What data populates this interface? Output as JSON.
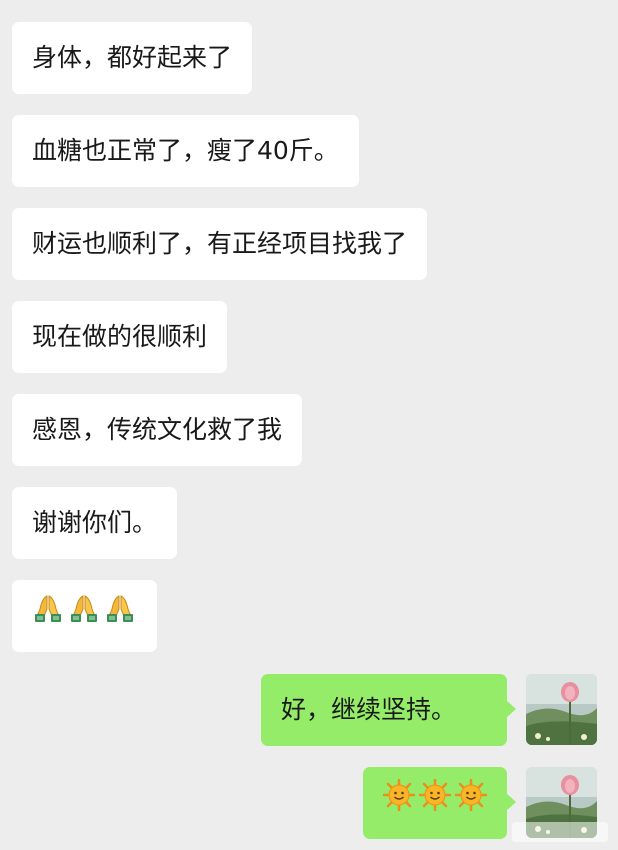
{
  "messages": [
    {
      "side": "in",
      "text": "身体，都好起来了"
    },
    {
      "side": "in",
      "text": "血糖也正常了，瘦了40斤。"
    },
    {
      "side": "in",
      "text": "财运也顺利了，有正经项目找我了"
    },
    {
      "side": "in",
      "text": "现在做的很顺利"
    },
    {
      "side": "in",
      "text": "感恩，传统文化救了我"
    },
    {
      "side": "in",
      "text": "谢谢你们。"
    },
    {
      "side": "in",
      "icons": [
        "pray-icon",
        "pray-icon",
        "pray-icon"
      ]
    },
    {
      "side": "out",
      "text": "好，继续坚持。"
    },
    {
      "side": "out",
      "icons": [
        "sun-icon",
        "sun-icon",
        "sun-icon"
      ]
    }
  ],
  "colors": {
    "background": "#ededed",
    "incoming_bubble": "#ffffff",
    "outgoing_bubble": "#95ec69"
  }
}
